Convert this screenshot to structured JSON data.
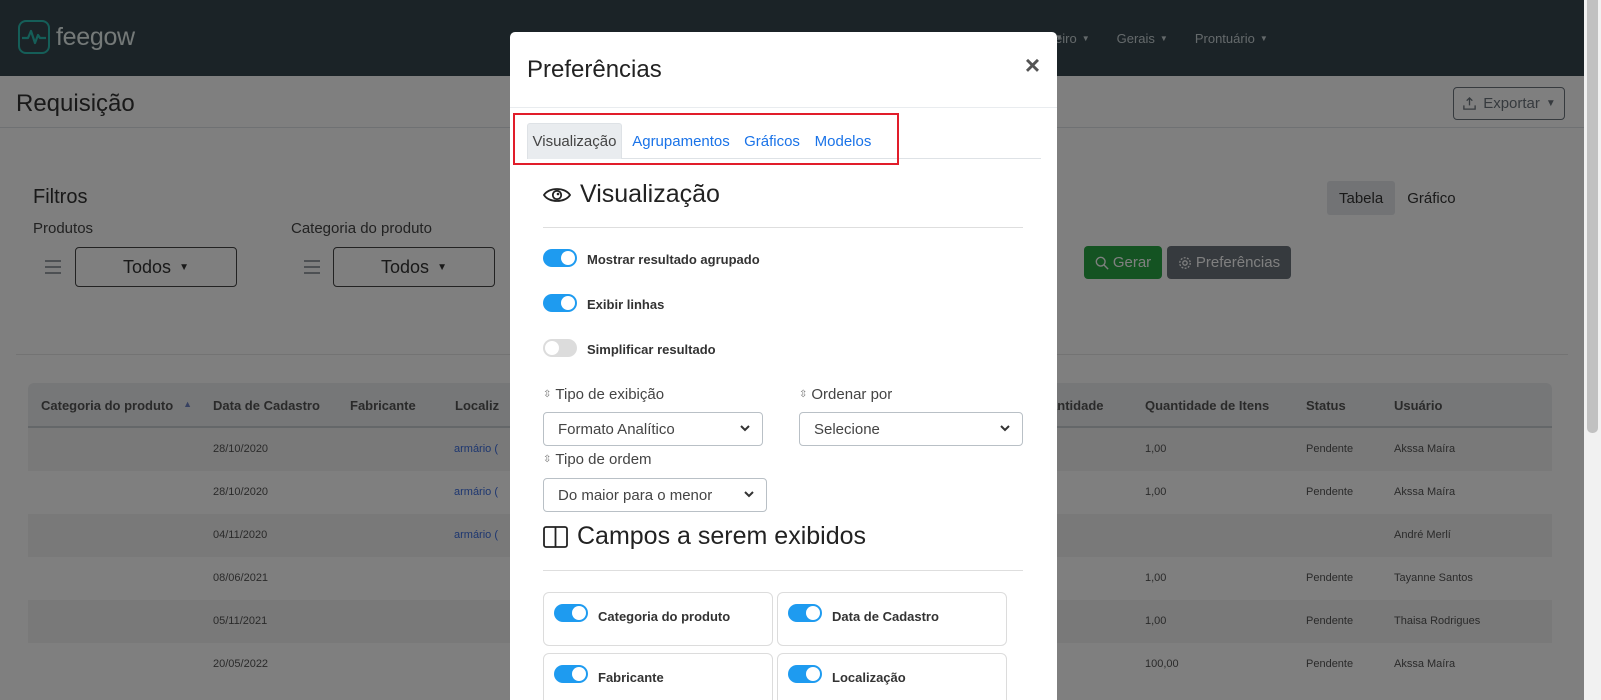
{
  "app": {
    "brand": "feegow",
    "nav": [
      {
        "label": "Financeiro"
      },
      {
        "label": "Gerais"
      },
      {
        "label": "Prontuário"
      }
    ]
  },
  "page": {
    "title": "Requisição",
    "export_label": "Exportar",
    "filters_title": "Filtros",
    "filters": [
      {
        "label": "Produtos",
        "value": "Todos"
      },
      {
        "label": "Categoria do produto",
        "value": "Todos"
      }
    ],
    "view_toggle": {
      "table": "Tabela",
      "chart": "Gráfico"
    },
    "generate_label": "Gerar",
    "preferences_label": "Preferências"
  },
  "table": {
    "columns": [
      "Categoria do produto",
      "Data de Cadastro",
      "Fabricante",
      "Localiz",
      "Quantidade",
      "Quantidade de Itens",
      "Status",
      "Usuário"
    ],
    "rows": [
      {
        "date": "28/10/2020",
        "location": "armário (",
        "items": "1,00",
        "status": "Pendente",
        "user": "Akssa Maíra"
      },
      {
        "date": "28/10/2020",
        "location": "armário (",
        "items": "1,00",
        "status": "Pendente",
        "user": "Akssa Maíra"
      },
      {
        "date": "04/11/2020",
        "location": "armário (",
        "items": "",
        "status": "",
        "user": "André Merlí"
      },
      {
        "date": "08/06/2021",
        "location": "",
        "items": "1,00",
        "status": "Pendente",
        "user": "Tayanne Santos"
      },
      {
        "date": "05/11/2021",
        "location": "",
        "items": "1,00",
        "status": "Pendente",
        "user": "Thaisa Rodrigues"
      },
      {
        "date": "20/05/2022",
        "location": "",
        "items": "100,00",
        "status": "Pendente",
        "user": "Akssa Maíra"
      }
    ]
  },
  "modal": {
    "title": "Preferências",
    "close": "×",
    "tabs": [
      {
        "label": "Visualização",
        "active": true
      },
      {
        "label": "Agrupamentos",
        "active": false
      },
      {
        "label": "Gráficos",
        "active": false
      },
      {
        "label": "Modelos",
        "active": false
      }
    ],
    "view_section": {
      "title": "Visualização",
      "toggles": [
        {
          "label": "Mostrar resultado agrupado",
          "on": true
        },
        {
          "label": "Exibir linhas",
          "on": true
        },
        {
          "label": "Simplificar resultado",
          "on": false
        }
      ],
      "display_type": {
        "label": "Tipo de exibição",
        "value": "Formato Analítico"
      },
      "order_by": {
        "label": "Ordenar por",
        "value": "Selecione"
      },
      "order_type": {
        "label": "Tipo de ordem",
        "value": "Do maior para o menor"
      }
    },
    "fields_section": {
      "title": "Campos a serem exibidos",
      "fields": [
        {
          "label": "Categoria do produto",
          "on": true
        },
        {
          "label": "Data de Cadastro",
          "on": true
        },
        {
          "label": "Fabricante",
          "on": true
        },
        {
          "label": "Localização",
          "on": true
        }
      ]
    }
  },
  "colors": {
    "nav_bg": "#37474f",
    "accent": "#1e9bf0",
    "success": "#28a745",
    "highlight": "#e11d2a"
  }
}
